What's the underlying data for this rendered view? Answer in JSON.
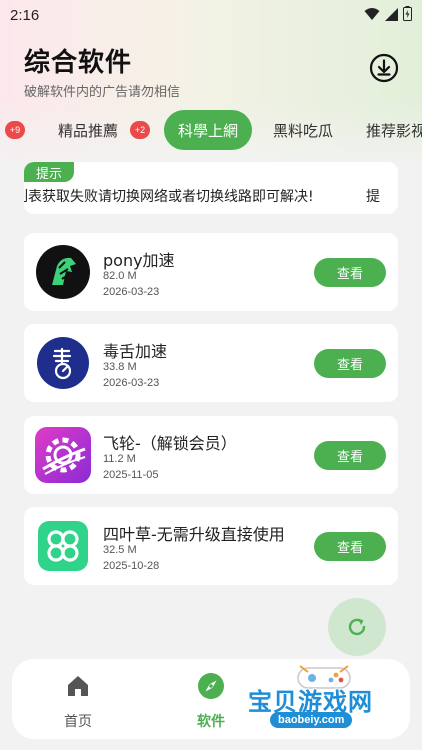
{
  "status_bar": {
    "time": "2:16"
  },
  "header": {
    "title": "综合软件",
    "subtitle": "破解软件内的广告请勿相信"
  },
  "tabs": [
    {
      "label": "精品推薦",
      "badge": "+2"
    },
    {
      "label": "科學上網",
      "active": true
    },
    {
      "label": "黑料吃瓜"
    },
    {
      "label": "推荐影视"
    }
  ],
  "left_badge": "+9",
  "notice": {
    "tag": "提示",
    "text": "列表获取失败请切换网络或者切换线路即可解决!",
    "text_tail": "提"
  },
  "apps": [
    {
      "name": "pony加速",
      "size": "82.0 M",
      "date": "2026-03-23",
      "button": "查看",
      "icon": "pony-horse-icon"
    },
    {
      "name": "毒舌加速",
      "size": "33.8 M",
      "date": "2026-03-23",
      "button": "查看",
      "icon": "dushe-logo-icon"
    },
    {
      "name": "飞轮-（解锁会员）",
      "size": "11.2 M",
      "date": "2025-11-05",
      "button": "查看",
      "icon": "flywheel-gear-icon"
    },
    {
      "name": "四叶草-无需升级直接使用",
      "size": "32.5 M",
      "date": "2025-10-28",
      "button": "查看",
      "icon": "clover-icon"
    }
  ],
  "bottom_nav": [
    {
      "label": "首页",
      "icon": "home-icon"
    },
    {
      "label": "软件",
      "icon": "compass-icon",
      "active": true
    }
  ],
  "watermark": {
    "title": "宝贝游戏网",
    "url": "baobeiy.com"
  },
  "colors": {
    "accent": "#4caf50",
    "badge": "#ea4a4a",
    "watermark": "#1e8fd6"
  }
}
